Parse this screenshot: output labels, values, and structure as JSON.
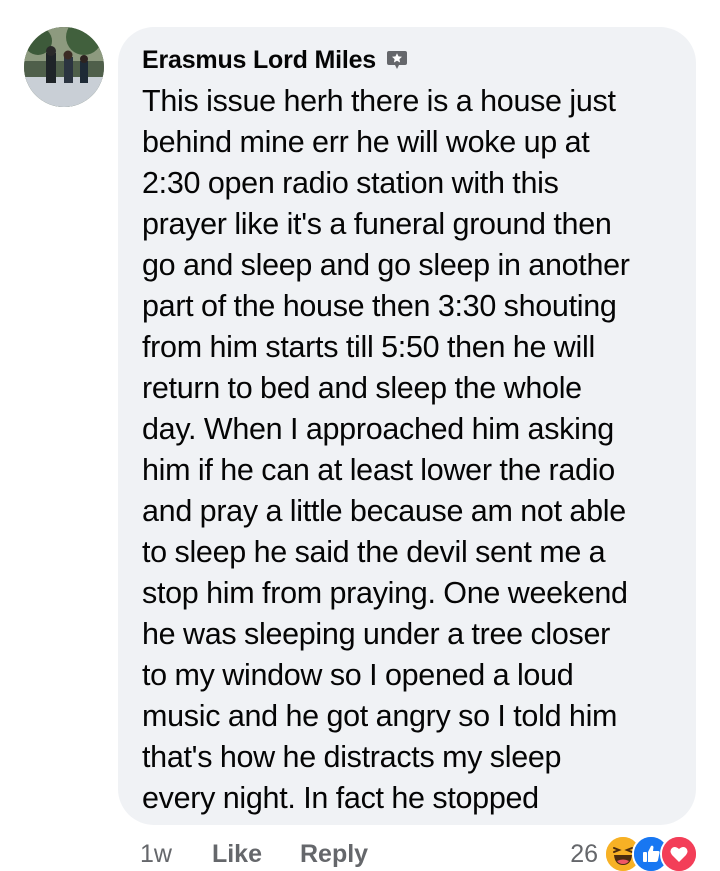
{
  "comment": {
    "author": "Erasmus Lord Miles",
    "author_badge_icon": "top-fan-badge-icon",
    "body": "This issue herh there is a house just behind mine err he will woke up at 2:30 open radio station with this prayer like it's a funeral ground then go and sleep and go sleep in another part of the house then 3:30 shouting from him starts till 5:50 then he will return to bed and sleep the whole day. When I approached him asking him if he can at least lower the radio and pray a little because am not able to sleep he said the devil sent me a stop him from praying. One weekend he was sleeping under a tree closer to my window so I opened a loud music and he got angry so I told him that's how he distracts my sleep every night. In fact he stopped",
    "body_lines": [
      "This issue herh there is a house just",
      "behind mine err he will woke up at",
      "2:30 open radio station with this",
      "prayer like it's a funeral ground then",
      "go and sleep and go sleep in another",
      "part of the house then 3:30 shouting",
      "from him starts till 5:50 then he will",
      "return to bed and sleep the whole",
      "day. When I approached him asking",
      "him if he can at least lower the radio",
      "and pray a little because am not able",
      "to sleep he said the devil sent me a",
      "stop him from praying. One weekend",
      "he was sleeping under a tree closer",
      "to my window so I opened a loud",
      "music and he got angry so I told him",
      "that's how he distracts my sleep",
      "every night. In fact he stopped"
    ]
  },
  "actions": {
    "time": "1w",
    "like_label": "Like",
    "reply_label": "Reply"
  },
  "reactions": {
    "count": "26",
    "icons": [
      "haha-reaction-icon",
      "like-reaction-icon",
      "love-reaction-icon"
    ]
  },
  "colors": {
    "bubble_bg": "#f0f2f5",
    "text": "#050505",
    "secondary_text": "#65676b",
    "like_blue": "#1877f2",
    "love_red": "#f33e58",
    "haha_yellow": "#f7b125"
  }
}
